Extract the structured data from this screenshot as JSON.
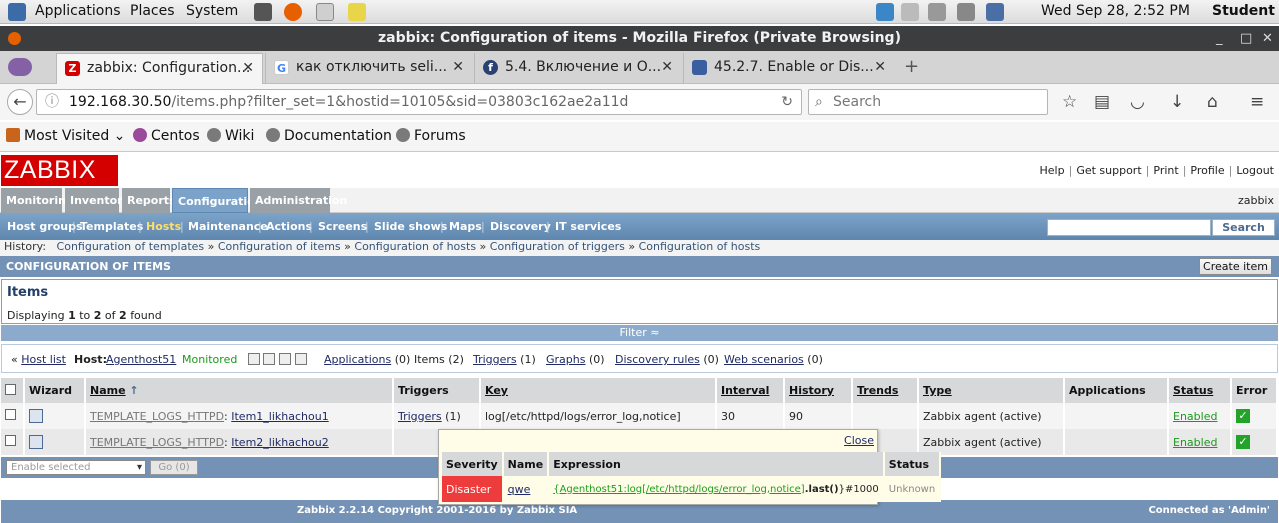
{
  "gnome_panel": {
    "menus": [
      "Applications",
      "Places",
      "System"
    ],
    "clock": "Wed Sep 28,  2:52 PM",
    "user": "Student"
  },
  "window": {
    "title": "zabbix: Configuration of items - Mozilla Firefox (Private Browsing)"
  },
  "tabs": [
    {
      "label": "zabbix: Configuration...",
      "icon": "zabbix-favicon"
    },
    {
      "label": "как отключить seli...",
      "icon": "google-favicon"
    },
    {
      "label": "5.4. Включение и О...",
      "icon": "fedora-favicon"
    },
    {
      "label": "45.2.7. Enable or Dis...",
      "icon": "doc-favicon"
    }
  ],
  "navbar": {
    "url_host": "192.168.30.50",
    "url_path": "/items.php?filter_set=1&hostid=10105&sid=03803c162ae2a11d",
    "search_placeholder": "Search"
  },
  "bookmarks": [
    "Most Visited",
    "Centos",
    "Wiki",
    "Documentation",
    "Forums"
  ],
  "zabbix": {
    "logo": "ZABBIX",
    "top_links": [
      "Help",
      "Get support",
      "Print",
      "Profile",
      "Logout"
    ],
    "username": "zabbix",
    "main_menu": [
      "Monitoring",
      "Inventory",
      "Reports",
      "Configuration",
      "Administration"
    ],
    "sub_menu": [
      "Host groups",
      "Templates",
      "Hosts",
      "Maintenance",
      "Actions",
      "Screens",
      "Slide shows",
      "Maps",
      "Discovery",
      "IT services"
    ],
    "search_button": "Search",
    "history_label": "History:",
    "history": [
      "Configuration of templates",
      "Configuration of items",
      "Configuration of hosts",
      "Configuration of triggers",
      "Configuration of hosts"
    ],
    "section_title": "CONFIGURATION OF ITEMS",
    "create_button": "Create item",
    "items_title": "Items",
    "displaying": {
      "prefix": "Displaying",
      "from": "1",
      "to_word": "to",
      "to": "2",
      "of_word": "of",
      "total": "2",
      "suffix": "found"
    },
    "filter_label": "Filter ≈",
    "hostbar": {
      "host_list": "Host list",
      "host_label": "Host:",
      "host_name": "Agenthost51",
      "status": "Monitored",
      "applications": "Applications",
      "applications_count": "(0)",
      "items": "Items",
      "items_count": "(2)",
      "triggers": "Triggers",
      "triggers_count": "(1)",
      "graphs": "Graphs",
      "graphs_count": "(0)",
      "discovery": "Discovery rules",
      "discovery_count": "(0)",
      "web": "Web scenarios",
      "web_count": "(0)"
    },
    "table": {
      "headers": [
        "Wizard",
        "Name",
        "Triggers",
        "Key",
        "Interval",
        "History",
        "Trends",
        "Type",
        "Applications",
        "Status",
        "Error"
      ],
      "rows": [
        {
          "template": "TEMPLATE_LOGS_HTTPD",
          "name": "Item1_likhachou1",
          "triggers": "Triggers",
          "triggers_count": "(1)",
          "key": "log[/etc/httpd/logs/error_log,notice]",
          "interval": "30",
          "history": "90",
          "trends": "",
          "type": "Zabbix agent (active)",
          "applications": "",
          "status": "Enabled"
        },
        {
          "template": "TEMPLATE_LOGS_HTTPD",
          "name": "Item2_likhachou2",
          "triggers": "",
          "triggers_count": "",
          "key": "",
          "interval": "",
          "history": "",
          "trends": "",
          "type": "Zabbix agent (active)",
          "applications": "",
          "status": "Enabled"
        }
      ]
    },
    "bulk": {
      "select_placeholder": "Enable selected",
      "go_button": "Go (0)"
    },
    "footer": {
      "copyright": "Zabbix 2.2.14 Copyright 2001-2016 by Zabbix SIA",
      "connected": "Connected as 'Admin'"
    },
    "popup": {
      "close": "Close",
      "headers": [
        "Severity",
        "Name",
        "Expression",
        "Status"
      ],
      "row": {
        "severity": "Disaster",
        "name": "qwe",
        "expression_link": "{Agenthost51:log[/etc/httpd/logs/error_log,notice]",
        "expression_func": ".last()",
        "expression_rest": "}#1000",
        "status": "Unknown"
      }
    }
  },
  "colors": {
    "zabbix_red": "#d40000",
    "menu_blue": "#7ba2c9",
    "section_blue": "#7492b5",
    "enabled_green": "#1a9a1a",
    "disaster_red": "#ee3b3b"
  }
}
